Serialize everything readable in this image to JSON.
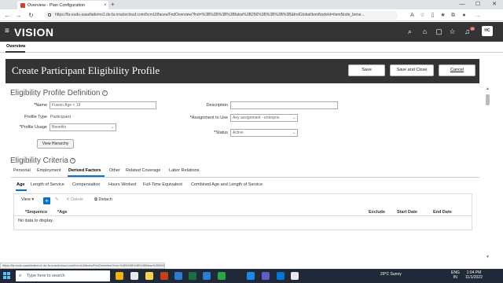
{
  "browser": {
    "tab_title": "Overview - Plan Configuration",
    "tab_close": "×",
    "new_tab": "+",
    "url": "https://fa-eudu-saasfademo1.ds-fa.oraclecloud.com/hcmUI/faces/FndOverview?fnd=%3B%3B%3B%3Bfalse%3B256%3B%3B%3B%3B&fndGlobalItemNodeId=itemNode_bene...",
    "minimize": "—",
    "maximize": "☐",
    "close": "✕"
  },
  "app": {
    "logo": "VISION",
    "notification_count": "20",
    "avatar_initials": "HC",
    "overview_tab": "Overview"
  },
  "page": {
    "title": "Create Participant Eligibility Profile",
    "buttons": {
      "save": "Save",
      "save_close": "Save and Close",
      "cancel": "Cancel"
    }
  },
  "definition": {
    "heading": "Eligibility Profile Definition",
    "name_label": "Name",
    "name_value": "Fusion Age < 19",
    "profile_type_label": "Profile Type",
    "profile_type_value": "Participant",
    "profile_usage_label": "Profile Usage",
    "profile_usage_value": "Benefits",
    "description_label": "Description",
    "description_value": "",
    "assignment_label": "Assignment to Use",
    "assignment_value": "Any assignment - enterpris",
    "status_label": "Status",
    "status_value": "Active",
    "view_hierarchy": "View Hierarchy",
    "required_mark": "*"
  },
  "criteria": {
    "heading": "Eligibility Criteria",
    "tabs": [
      "Personal",
      "Employment",
      "Derived Factors",
      "Other",
      "Related Coverage",
      "Labor Relations"
    ],
    "active_tab": "Derived Factors",
    "subtabs": [
      "Age",
      "Length of Service",
      "Compensation",
      "Hours Worked",
      "Full-Time Equivalent",
      "Combined Age and Length of Service"
    ],
    "active_subtab": "Age",
    "toolbar": {
      "view": "View",
      "delete": "Delete",
      "detach": "Detach"
    },
    "columns": [
      "*Sequence",
      "*Age",
      "Exclude",
      "Start Date",
      "End Date"
    ],
    "no_data": "No data to display."
  },
  "taskbar": {
    "search_placeholder": "Type here to search",
    "weather": "29°C  Sunny",
    "lang_line1": "ENG",
    "lang_line2": "IN",
    "time": "1:04 PM",
    "date": "11/1/2022"
  },
  "colors": {
    "header_bg": "#333436",
    "accent": "#0572ce",
    "taskbar_bg": "#1f2937"
  }
}
